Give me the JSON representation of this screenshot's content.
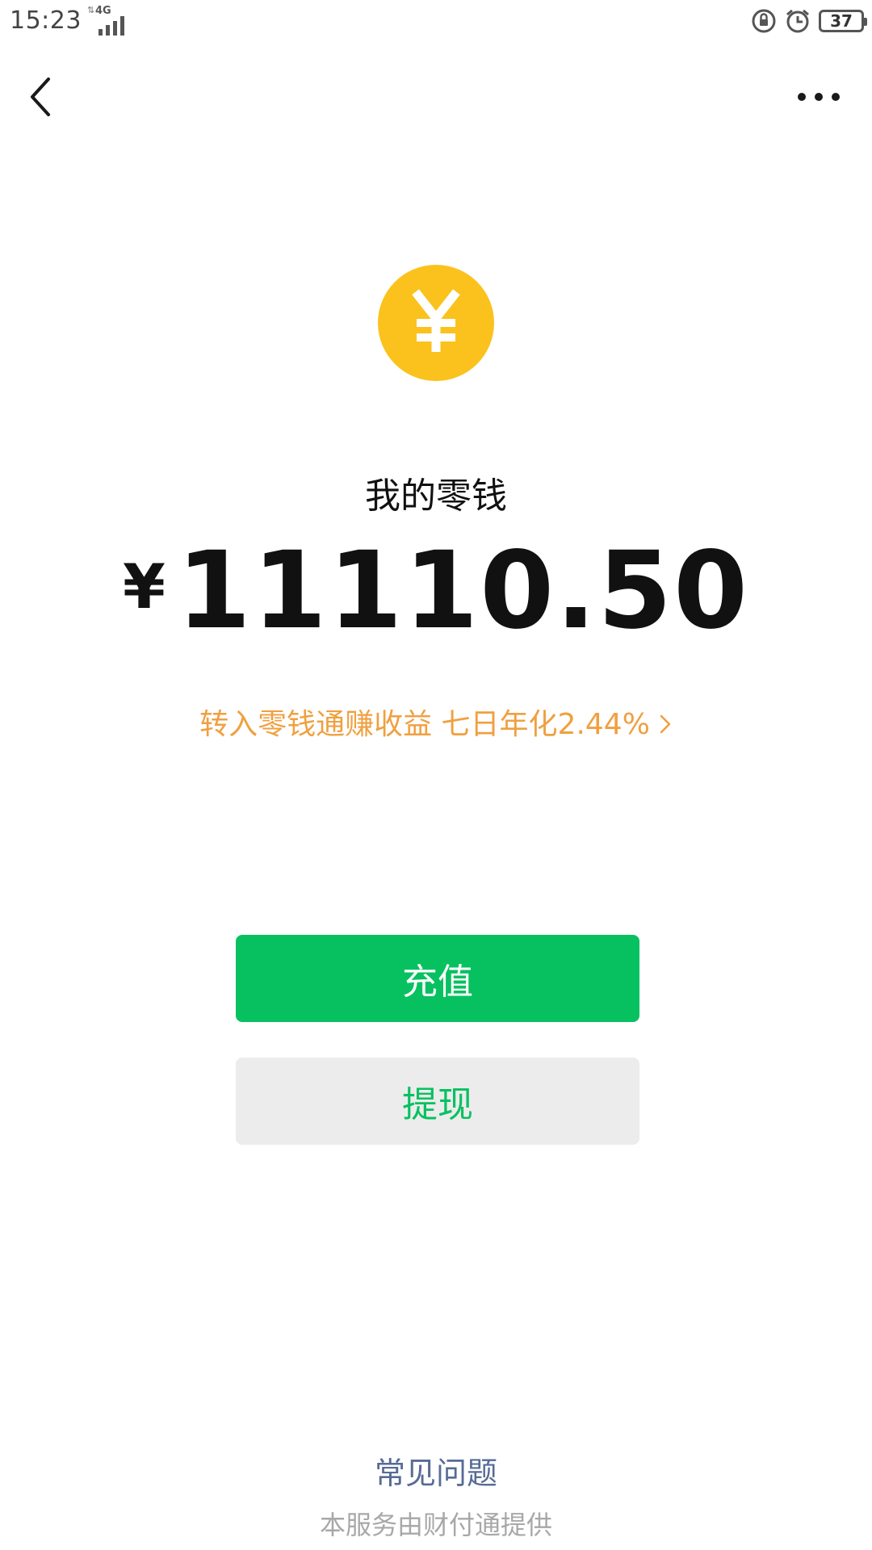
{
  "status_bar": {
    "time": "15:23",
    "network": "4G",
    "battery": "37"
  },
  "nav": {
    "back_icon": "chevron-left-icon",
    "more_icon": "more-horizontal-icon"
  },
  "wallet": {
    "coin_icon": "yuan-coin-icon",
    "coin_color": "#FBC21D",
    "title": "我的零钱",
    "currency_symbol": "¥",
    "balance": "11110.50",
    "promo_text": "转入零钱通赚收益 七日年化2.44%",
    "promo_color": "#F0A040"
  },
  "actions": {
    "recharge_label": "充值",
    "withdraw_label": "提现",
    "accent_color": "#07C160"
  },
  "footer": {
    "faq_label": "常见问题",
    "provider_text": "本服务由财付通提供",
    "link_color": "#576B95"
  }
}
